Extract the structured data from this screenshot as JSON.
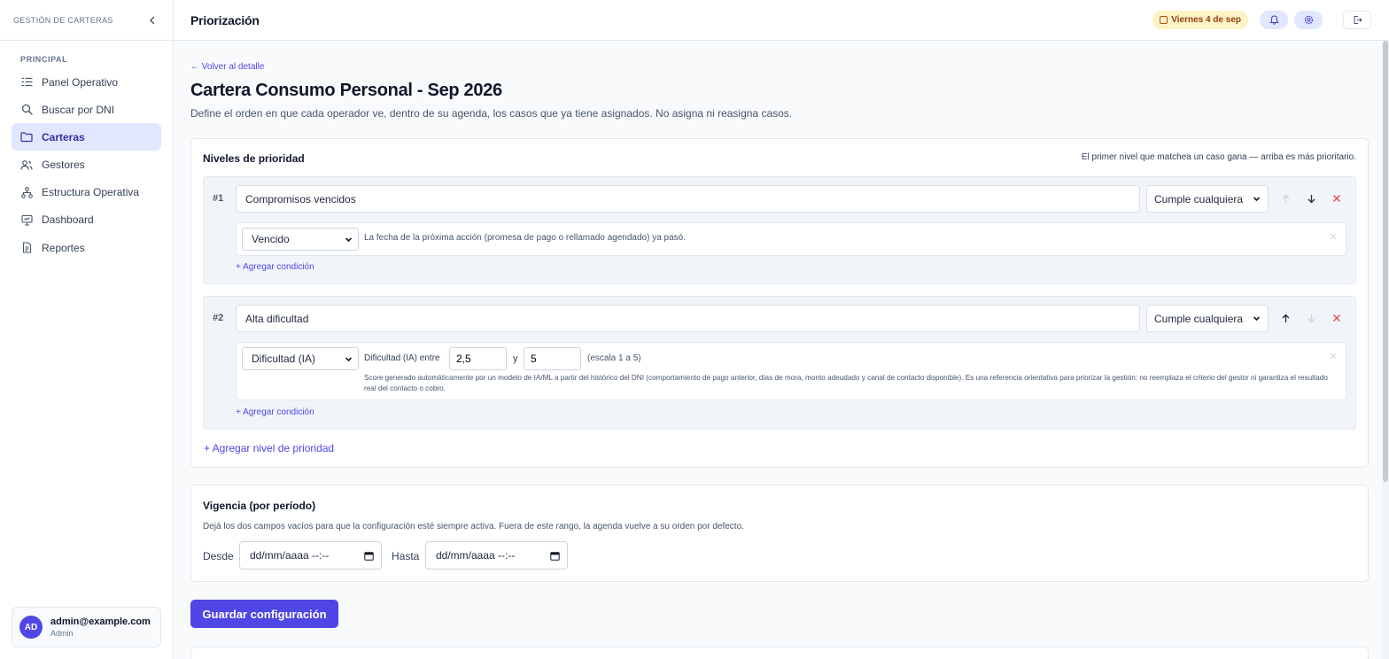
{
  "sidebar": {
    "brand": "GESTIÓN DE CARTERAS",
    "section": "PRINCIPAL",
    "items": [
      {
        "label": "Panel Operativo",
        "icon": "list-icon"
      },
      {
        "label": "Buscar por DNI",
        "icon": "search-icon"
      },
      {
        "label": "Carteras",
        "icon": "folder-icon",
        "active": true
      },
      {
        "label": "Gestores",
        "icon": "users-icon"
      },
      {
        "label": "Estructura Operativa",
        "icon": "org-chart-icon"
      },
      {
        "label": "Dashboard",
        "icon": "presentation-icon"
      },
      {
        "label": "Reportes",
        "icon": "document-icon"
      }
    ],
    "user": {
      "initials": "AD",
      "email": "admin@example.com",
      "role": "Admin"
    }
  },
  "topbar": {
    "title": "Priorización",
    "date": "Viernes 4 de sep"
  },
  "main": {
    "back_link": "← Volver al detalle",
    "title": "Cartera Consumo Personal - Sep 2026",
    "description": "Define el orden en que cada operador ve, dentro de su agenda, los casos que ya tiene asignados. No asigna ni reasigna casos."
  },
  "priority": {
    "title": "Niveles de prioridad",
    "hint": "El primer nivel que matchea un caso gana — arriba es más prioritario.",
    "add_level": "+ Agregar nivel de prioridad",
    "levels": [
      {
        "number": "#1",
        "name": "Compromisos vencidos",
        "mode": "Cumple cualquiera",
        "condition": {
          "field": "Vencido",
          "description": "La fecha de la próxima acción (promesa de pago o rellamado agendado) ya pasó."
        },
        "add_condition": "+ Agregar condición"
      },
      {
        "number": "#2",
        "name": "Alta dificultad",
        "mode": "Cumple cualquiera",
        "condition": {
          "field": "Dificultad (IA)",
          "range_label": "Dificultad (IA) entre",
          "min": "2,5",
          "joiner": "y",
          "max": "5",
          "scale": "(escala 1 a 5)",
          "note": "Score generado automáticamente por un modelo de IA/ML a partir del histórico del DNI (comportamiento de pago anterior, días de mora, monto adeudado y canal de contacto disponible). Es una referencia orientativa para priorizar la gestión: no reemplaza el criterio del gestor ni garantiza el resultado real del contacto o cobro."
        },
        "add_condition": "+ Agregar condición"
      }
    ]
  },
  "vigencia": {
    "title": "Vigencia (por período)",
    "description": "Dejá los dos campos vacíos para que la configuración esté siempre activa. Fuera de este rango, la agenda vuelve a su orden por defecto.",
    "from_label": "Desde",
    "from_placeholder": "dd/mm/aaaa --:--",
    "to_label": "Hasta",
    "to_placeholder": "dd/mm/aaaa --:--"
  },
  "save_button": "Guardar configuración",
  "colors": {
    "accent": "#4f46e5",
    "active_bg": "#e0e7ff",
    "danger": "#ef4444",
    "date_badge_bg": "#fef3c7"
  }
}
